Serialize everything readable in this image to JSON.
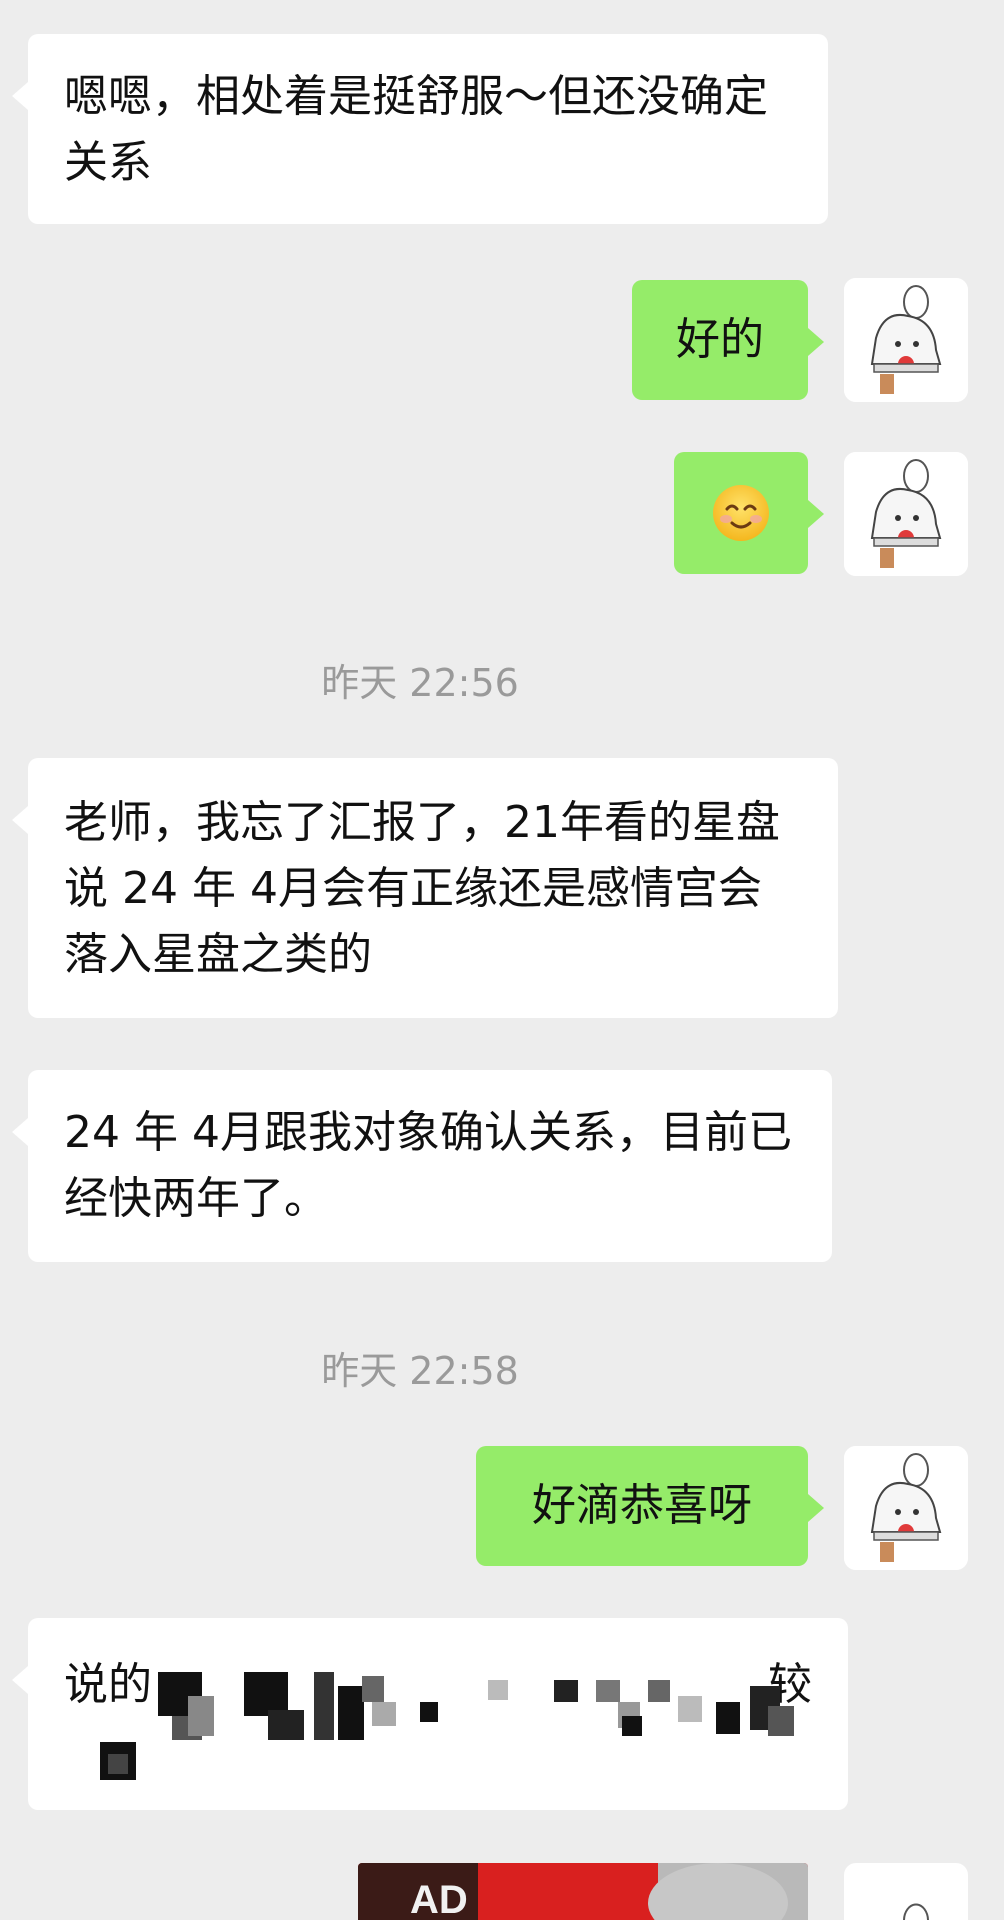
{
  "messages": [
    {
      "id": "m1",
      "side": "in",
      "text": "嗯嗯，相处着是挺舒服～但还没确定关系"
    },
    {
      "id": "m2",
      "side": "out",
      "text": "好的"
    },
    {
      "id": "m3",
      "side": "out",
      "emoji": "smiling-face-emoji"
    },
    {
      "id": "t1",
      "type": "timestamp",
      "text": "昨天 22:56"
    },
    {
      "id": "m4",
      "side": "in",
      "text": "老师，我忘了汇报了，21年看的星盘说 24 年 4月会有正缘还是感情宫会落入星盘之类的"
    },
    {
      "id": "m5",
      "side": "in",
      "text": "24 年 4月跟我对象确认关系，目前已经快两年了。"
    },
    {
      "id": "t2",
      "type": "timestamp",
      "text": "昨天 22:58"
    },
    {
      "id": "m6",
      "side": "out",
      "text": "好滴恭喜呀"
    },
    {
      "id": "m7",
      "side": "in",
      "text_prefix": "说的",
      "text_suffix": "较",
      "pixelated": true
    },
    {
      "id": "m8",
      "side": "out",
      "image": "red-shirt-photo",
      "image_text": "AD"
    }
  ],
  "colors": {
    "background": "#ededed",
    "incoming_bubble": "#ffffff",
    "outgoing_bubble": "#95ec69",
    "timestamp_text": "#9a9a9a"
  },
  "icons": {
    "avatar": "cartoon-girl-avatar"
  }
}
